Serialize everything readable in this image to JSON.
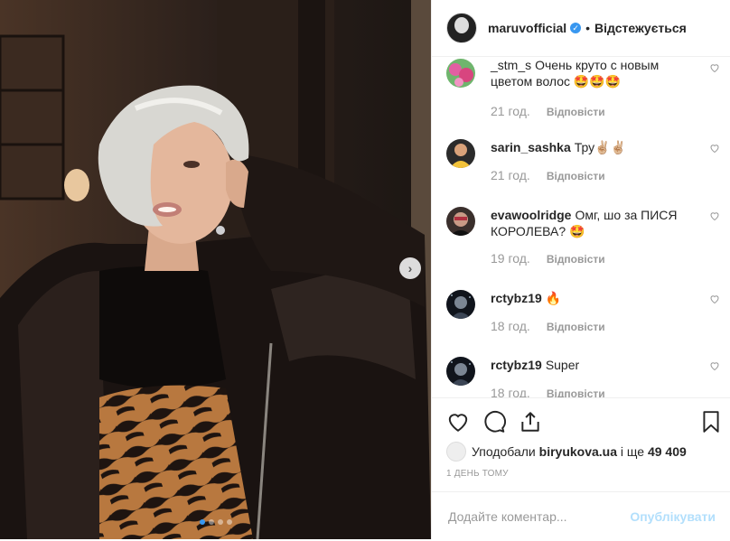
{
  "photo": {
    "carousel_total": 4,
    "carousel_active": 1,
    "next_label": "›"
  },
  "header": {
    "username": "maruvofficial",
    "verified_mark": "✓",
    "bullet": "•",
    "follow_label": "Відстежується"
  },
  "comments": [
    {
      "user": "_stm_s",
      "text": "Очень круто с новым цветом волос 🤩🤩🤩",
      "time": "21 год.",
      "reply": "Відповісти",
      "avatar": "flowers"
    },
    {
      "user": "sarin_sashka",
      "text": "Тру✌🏼✌🏼",
      "time": "21 год.",
      "reply": "Відповісти",
      "avatar": "yellow"
    },
    {
      "user": "evawoolridge",
      "text": "Омг, шо за ПИСЯ КОРОЛЕВА? 🤩",
      "time": "19 год.",
      "reply": "Відповісти",
      "avatar": "dark"
    },
    {
      "user": "rctybz19",
      "text": "🔥",
      "time": "18 год.",
      "reply": "Відповісти",
      "avatar": "space"
    },
    {
      "user": "rctybz19",
      "text": "Super",
      "time": "18 год.",
      "reply": "Відповісти",
      "avatar": "space"
    }
  ],
  "likes": {
    "prefix": "Уподобали",
    "user": "biryukova.ua",
    "middle": "і ще",
    "count": "49 409"
  },
  "date": "1 ДЕНЬ ТОМУ",
  "add_comment": {
    "placeholder": "Додайте коментар...",
    "publish_label": "Опублікувати"
  },
  "colors": {
    "accent": "#3897f0",
    "publish_disabled": "#b2dffc",
    "text": "#262626",
    "muted": "#999999"
  }
}
